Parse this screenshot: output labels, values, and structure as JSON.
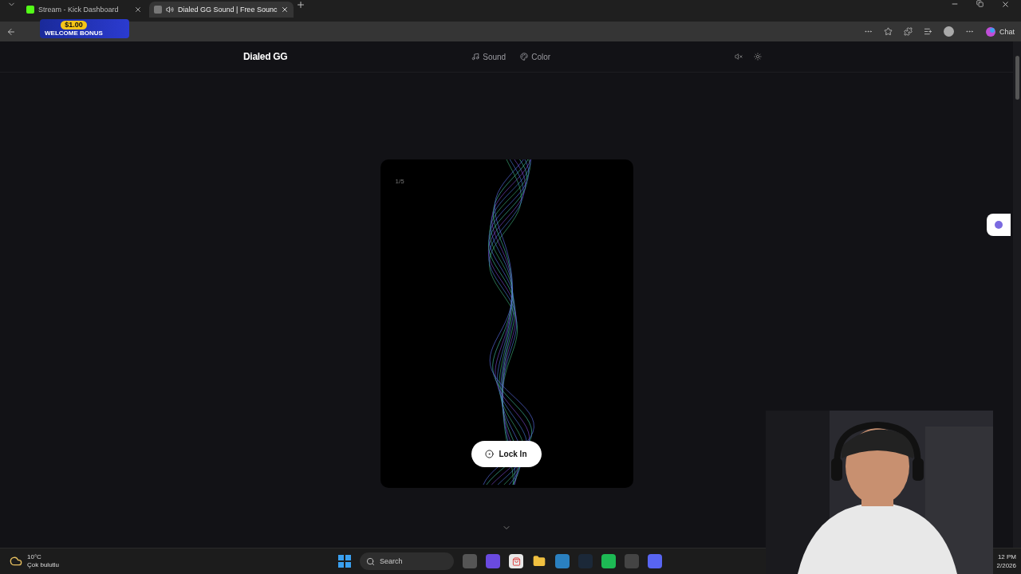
{
  "browser": {
    "tabs": [
      {
        "title": "Stream - Kick Dashboard",
        "selected": false,
        "audio": false
      },
      {
        "title": "Dialed GG Sound | Free Sounc",
        "selected": true,
        "audio": true
      }
    ],
    "chat_label": "Chat"
  },
  "overlay": {
    "amount": "$1.00",
    "caption": "WELCOME BONUS"
  },
  "site": {
    "logo": "Dialed GG",
    "nav": [
      {
        "label": "Sound",
        "kind": "sound"
      },
      {
        "label": "Color",
        "kind": "color"
      }
    ]
  },
  "card": {
    "counter": "1/5",
    "button": "Lock In"
  },
  "taskbar": {
    "weather_temp": "10°C",
    "weather_text": "Çok bulutlu",
    "search_placeholder": "Search",
    "clock_time": "12 PM",
    "clock_date": "2/2026"
  }
}
